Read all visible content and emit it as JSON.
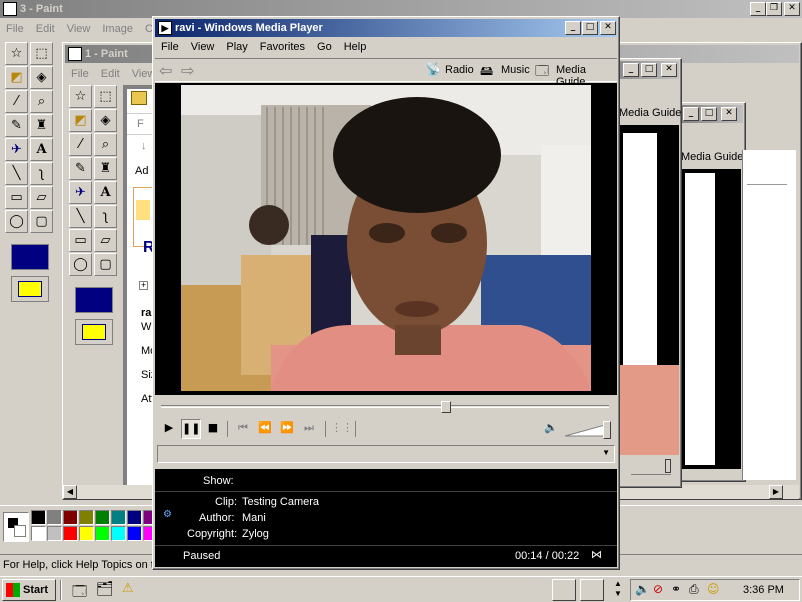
{
  "paint3": {
    "title": "3 - Paint",
    "menu": [
      "File",
      "Edit",
      "View",
      "Image",
      "Co"
    ],
    "status": "For Help, click Help Topics on th"
  },
  "paint1": {
    "title": "1 - Paint",
    "menu": [
      "File",
      "Edit",
      "View"
    ],
    "canvas_heading": "R",
    "canvas_lines": [
      "ra",
      "Wi",
      "Mo",
      "Siz",
      "Att"
    ],
    "canvas_toolbar_text": "Ad"
  },
  "bg_wmp": {
    "media_guide": "Media Guide"
  },
  "wmp": {
    "title": "ravi - Windows Media Player",
    "menu": [
      "File",
      "View",
      "Play",
      "Favorites",
      "Go",
      "Help"
    ],
    "taskbar_links": [
      "Radio",
      "Music",
      "Media Guide"
    ],
    "seek_fraction": 0.64,
    "info": {
      "show_label": "Show:",
      "clip_label": "Clip:",
      "clip_value": "Testing Camera",
      "author_label": "Author:",
      "author_value": "Mani",
      "copyright_label": "Copyright:",
      "copyright_value": "Zylog"
    },
    "status": "Paused",
    "time": "00:14 / 00:22"
  },
  "taskbar": {
    "start_label": "Start",
    "clock": "3:36 PM"
  },
  "colors": {
    "desktop": "#3a6ea5",
    "title_active": "#0a246a",
    "title_inactive": "#808080",
    "face": "#d4d0c8",
    "wmp_dark": "#000000"
  },
  "palette": [
    "#000000",
    "#808080",
    "#800000",
    "#808000",
    "#008000",
    "#008080",
    "#000080",
    "#800080",
    "#808040",
    "#004040",
    "#0080ff",
    "#004080",
    "#ffffff",
    "#c0c0c0",
    "#ff0000",
    "#ffff00",
    "#00ff00",
    "#00ffff",
    "#0000ff",
    "#ff00ff",
    "#ffff80",
    "#00ff80",
    "#80ffff",
    "#8080ff"
  ]
}
